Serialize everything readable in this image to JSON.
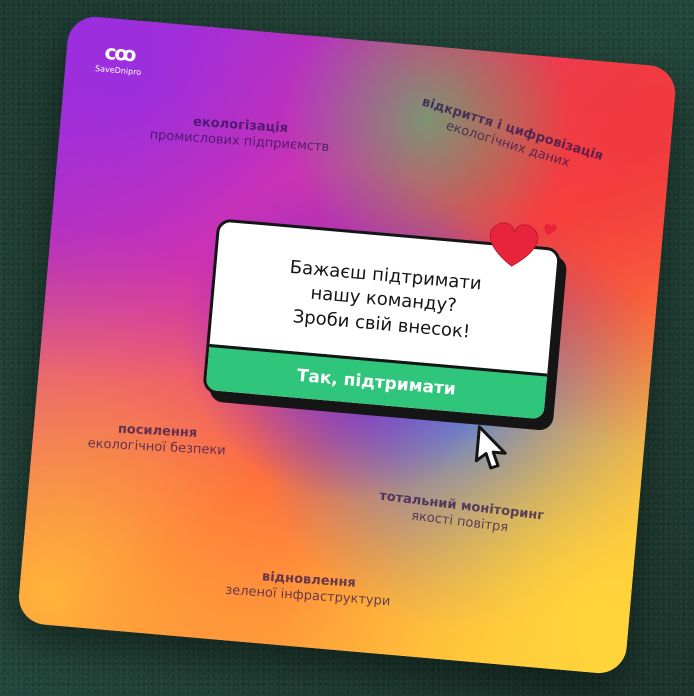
{
  "logo": {
    "mark": "cꝏ",
    "text": "SaveDnipro"
  },
  "topics": {
    "tl": {
      "line1": "екологізація",
      "line2": "промислових підприємств"
    },
    "tr": {
      "line1": "відкриття і цифровізація",
      "line2": "екологічних даних"
    },
    "ml": {
      "line1": "посилення",
      "line2": "екологічної безпеки"
    },
    "mr": {
      "line1": "тотальний моніторинг",
      "line2": "якості повітря"
    },
    "bm": {
      "line1": "відновлення",
      "line2": "зеленої інфраструктури"
    }
  },
  "dialog": {
    "line1": "Бажаєш підтримати",
    "line2": "нашу команду?",
    "line3": "Зроби свій внесок!",
    "button": "Так, підтримати"
  },
  "colors": {
    "accent_green": "#2fc57a",
    "heart_red": "#e8243c"
  },
  "icons": [
    "logo-icon",
    "heart-icon",
    "cursor-icon"
  ]
}
